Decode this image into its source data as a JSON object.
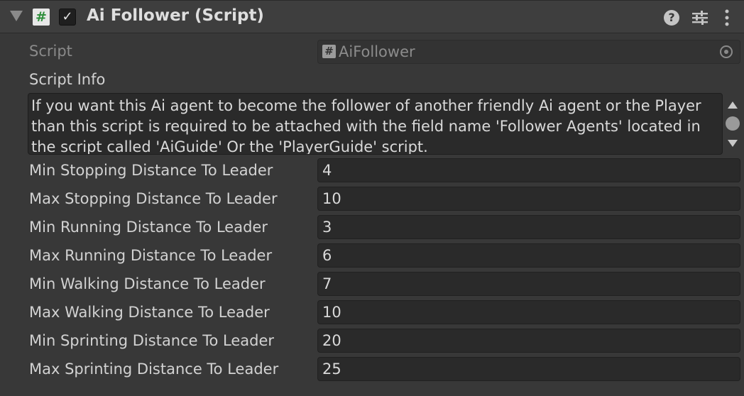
{
  "component": {
    "title": "Ai Follower (Script)",
    "enabled": true,
    "icons": {
      "header": "csharp-script-icon",
      "help": "help-icon",
      "presets": "presets-icon",
      "menu": "kebab-menu-icon"
    }
  },
  "script_row": {
    "label": "Script",
    "value": "AiFollower"
  },
  "script_info": {
    "label": "Script Info",
    "text": "If you want this Ai agent to become the follower of another friendly Ai agent or the Player than this script is required to be attached with the field name 'Follower Agents' located in the script called 'AiGuide' Or the 'PlayerGuide' script."
  },
  "fields": [
    {
      "label": "Min Stopping Distance To Leader",
      "value": "4"
    },
    {
      "label": "Max Stopping Distance To Leader",
      "value": "10"
    },
    {
      "label": "Min Running Distance To Leader",
      "value": "3"
    },
    {
      "label": "Max Running Distance To Leader",
      "value": "6"
    },
    {
      "label": "Min Walking Distance To Leader",
      "value": "7"
    },
    {
      "label": "Max Walking Distance To Leader",
      "value": "10"
    },
    {
      "label": "Min Sprinting Distance To Leader",
      "value": "20"
    },
    {
      "label": "Max Sprinting Distance To Leader",
      "value": "25"
    }
  ],
  "colors": {
    "background": "#383838",
    "header": "#3e3e3e",
    "field": "#2a2a2a",
    "text": "#d2d2d2",
    "script_icon_green": "#2f8f3c"
  }
}
